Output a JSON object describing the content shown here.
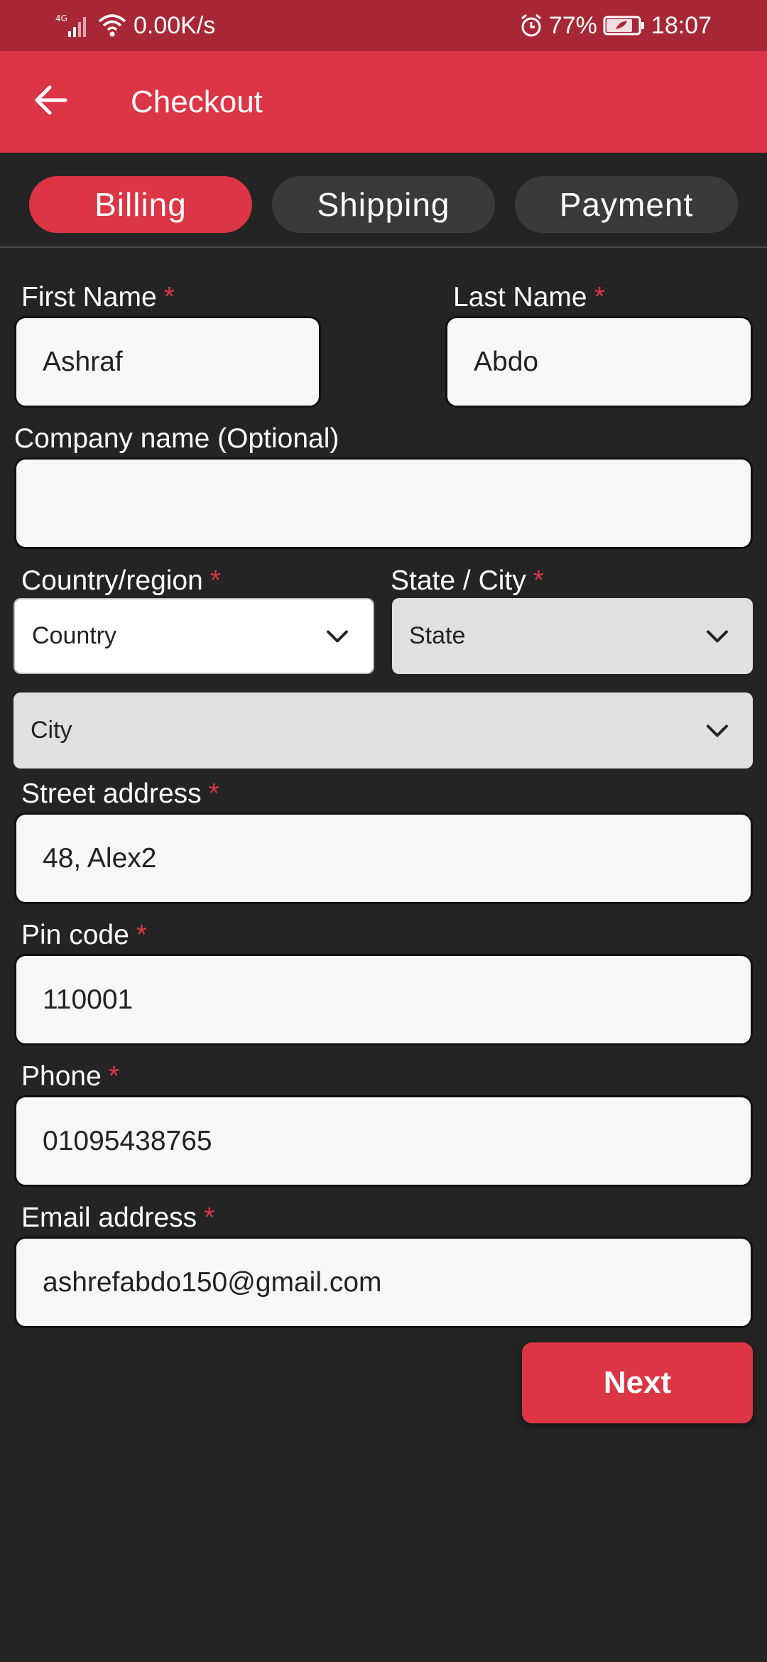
{
  "status_bar": {
    "network": "4G",
    "speed": "0.00K/s",
    "battery": "77%",
    "time": "18:07"
  },
  "app_bar": {
    "title": "Checkout"
  },
  "tabs": [
    {
      "label": "Billing",
      "active": true
    },
    {
      "label": "Shipping",
      "active": false
    },
    {
      "label": "Payment",
      "active": false
    }
  ],
  "form": {
    "required_marker": "*",
    "first_name": {
      "label": "First Name",
      "value": "Ashraf"
    },
    "last_name": {
      "label": "Last Name",
      "value": "Abdo"
    },
    "company": {
      "label": "Company name (Optional)",
      "value": ""
    },
    "country": {
      "label": "Country/region",
      "value": "Country"
    },
    "state_city": {
      "label": "State / City",
      "state_value": "State",
      "city_value": "City"
    },
    "street": {
      "label": "Street address",
      "value": "48, Alex2"
    },
    "pin": {
      "label": "Pin code",
      "value": "110001"
    },
    "phone": {
      "label": "Phone",
      "value": "01095438765"
    },
    "email": {
      "label": "Email address",
      "value": "ashrefabdo150@gmail.com"
    },
    "next_label": "Next"
  },
  "colors": {
    "accent": "#dc3545",
    "status_bar": "#a82737",
    "background": "#242424",
    "field_bg": "#f6f7f9"
  }
}
